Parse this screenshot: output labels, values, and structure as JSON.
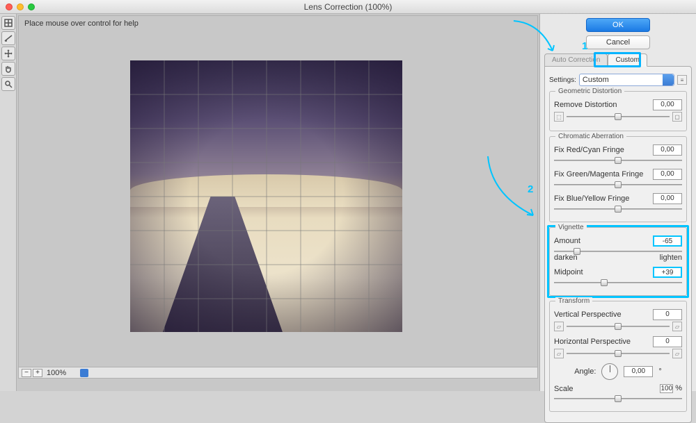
{
  "window": {
    "title": "Lens Correction (100%)"
  },
  "hint": "Place mouse over control for help",
  "footer": {
    "zoom": "100%"
  },
  "buttons": {
    "ok": "OK",
    "cancel": "Cancel"
  },
  "tabs": {
    "auto": "Auto Correction",
    "custom": "Custom"
  },
  "settings": {
    "label": "Settings:",
    "value": "Custom"
  },
  "groups": {
    "geo": {
      "legend": "Geometric Distortion",
      "remove": {
        "label": "Remove Distortion",
        "value": "0,00",
        "pos": 50
      }
    },
    "chrom": {
      "legend": "Chromatic Aberration",
      "red": {
        "label": "Fix Red/Cyan Fringe",
        "value": "0,00",
        "pos": 50
      },
      "green": {
        "label": "Fix Green/Magenta Fringe",
        "value": "0,00",
        "pos": 50
      },
      "blue": {
        "label": "Fix Blue/Yellow Fringe",
        "value": "0,00",
        "pos": 50
      }
    },
    "vign": {
      "legend": "Vignette",
      "amount": {
        "label": "Amount",
        "value": "-65",
        "pos": 18
      },
      "darken": "darken",
      "lighten": "lighten",
      "midpoint": {
        "label": "Midpoint",
        "value": "+39",
        "pos": 39
      }
    },
    "trans": {
      "legend": "Transform",
      "v": {
        "label": "Vertical Perspective",
        "value": "0",
        "pos": 50
      },
      "h": {
        "label": "Horizontal Perspective",
        "value": "0",
        "pos": 50
      },
      "angle": {
        "label": "Angle:",
        "value": "0,00",
        "unit": "°"
      },
      "scale": {
        "label": "Scale",
        "value": "100",
        "unit": "%",
        "pos": 50
      }
    }
  },
  "annotations": {
    "one": "1",
    "two": "2"
  }
}
